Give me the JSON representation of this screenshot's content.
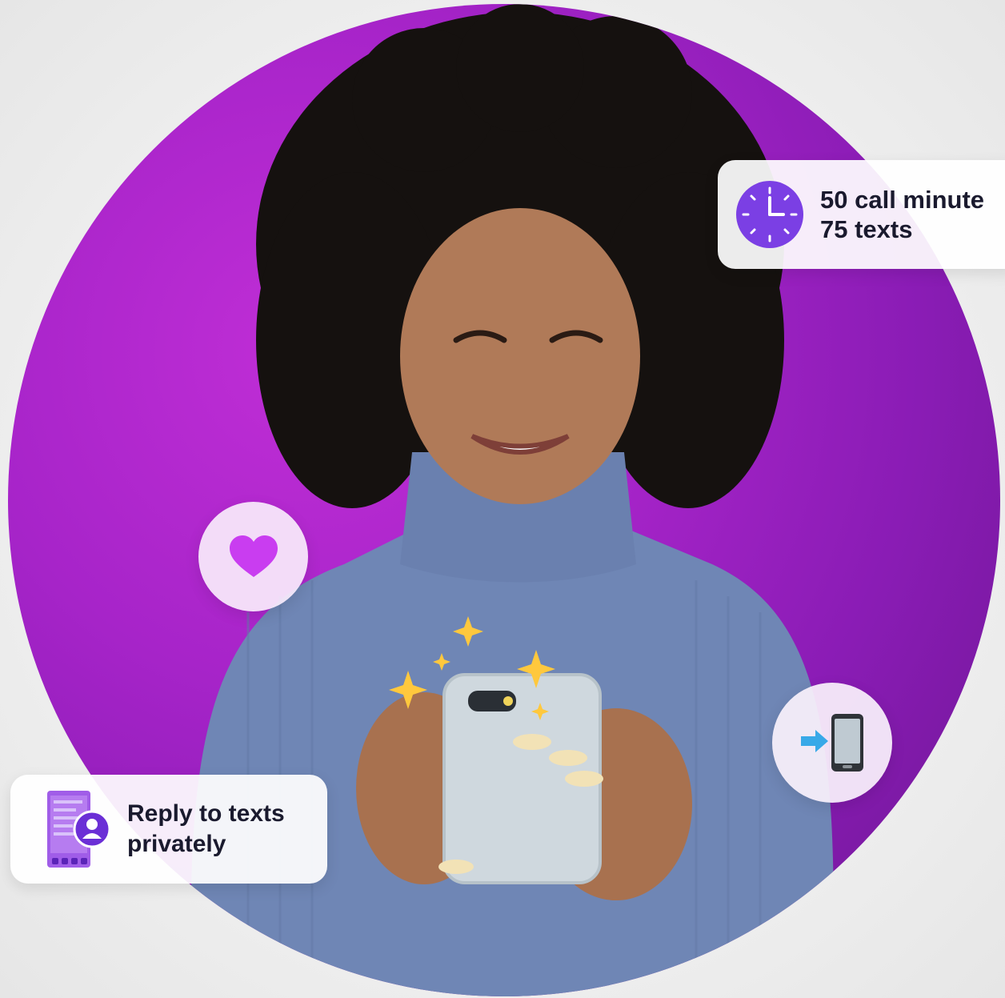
{
  "colors": {
    "accent": "#7b3fe4",
    "circle_bg": "#a724c9",
    "heart": "#c93df0",
    "card_text": "#1a1a2e",
    "sparkle": "#ffc83d"
  },
  "cards": {
    "minutes": {
      "icon": "clock-icon",
      "line1": "50 call minute",
      "line2": "75 texts"
    },
    "reply": {
      "icon": "private-reply-phone-icon",
      "line1": "Reply to texts",
      "line2": "privately"
    }
  },
  "bubbles": {
    "heart": {
      "icon": "heart-icon"
    },
    "transfer": {
      "icon": "phone-transfer-icon"
    }
  }
}
